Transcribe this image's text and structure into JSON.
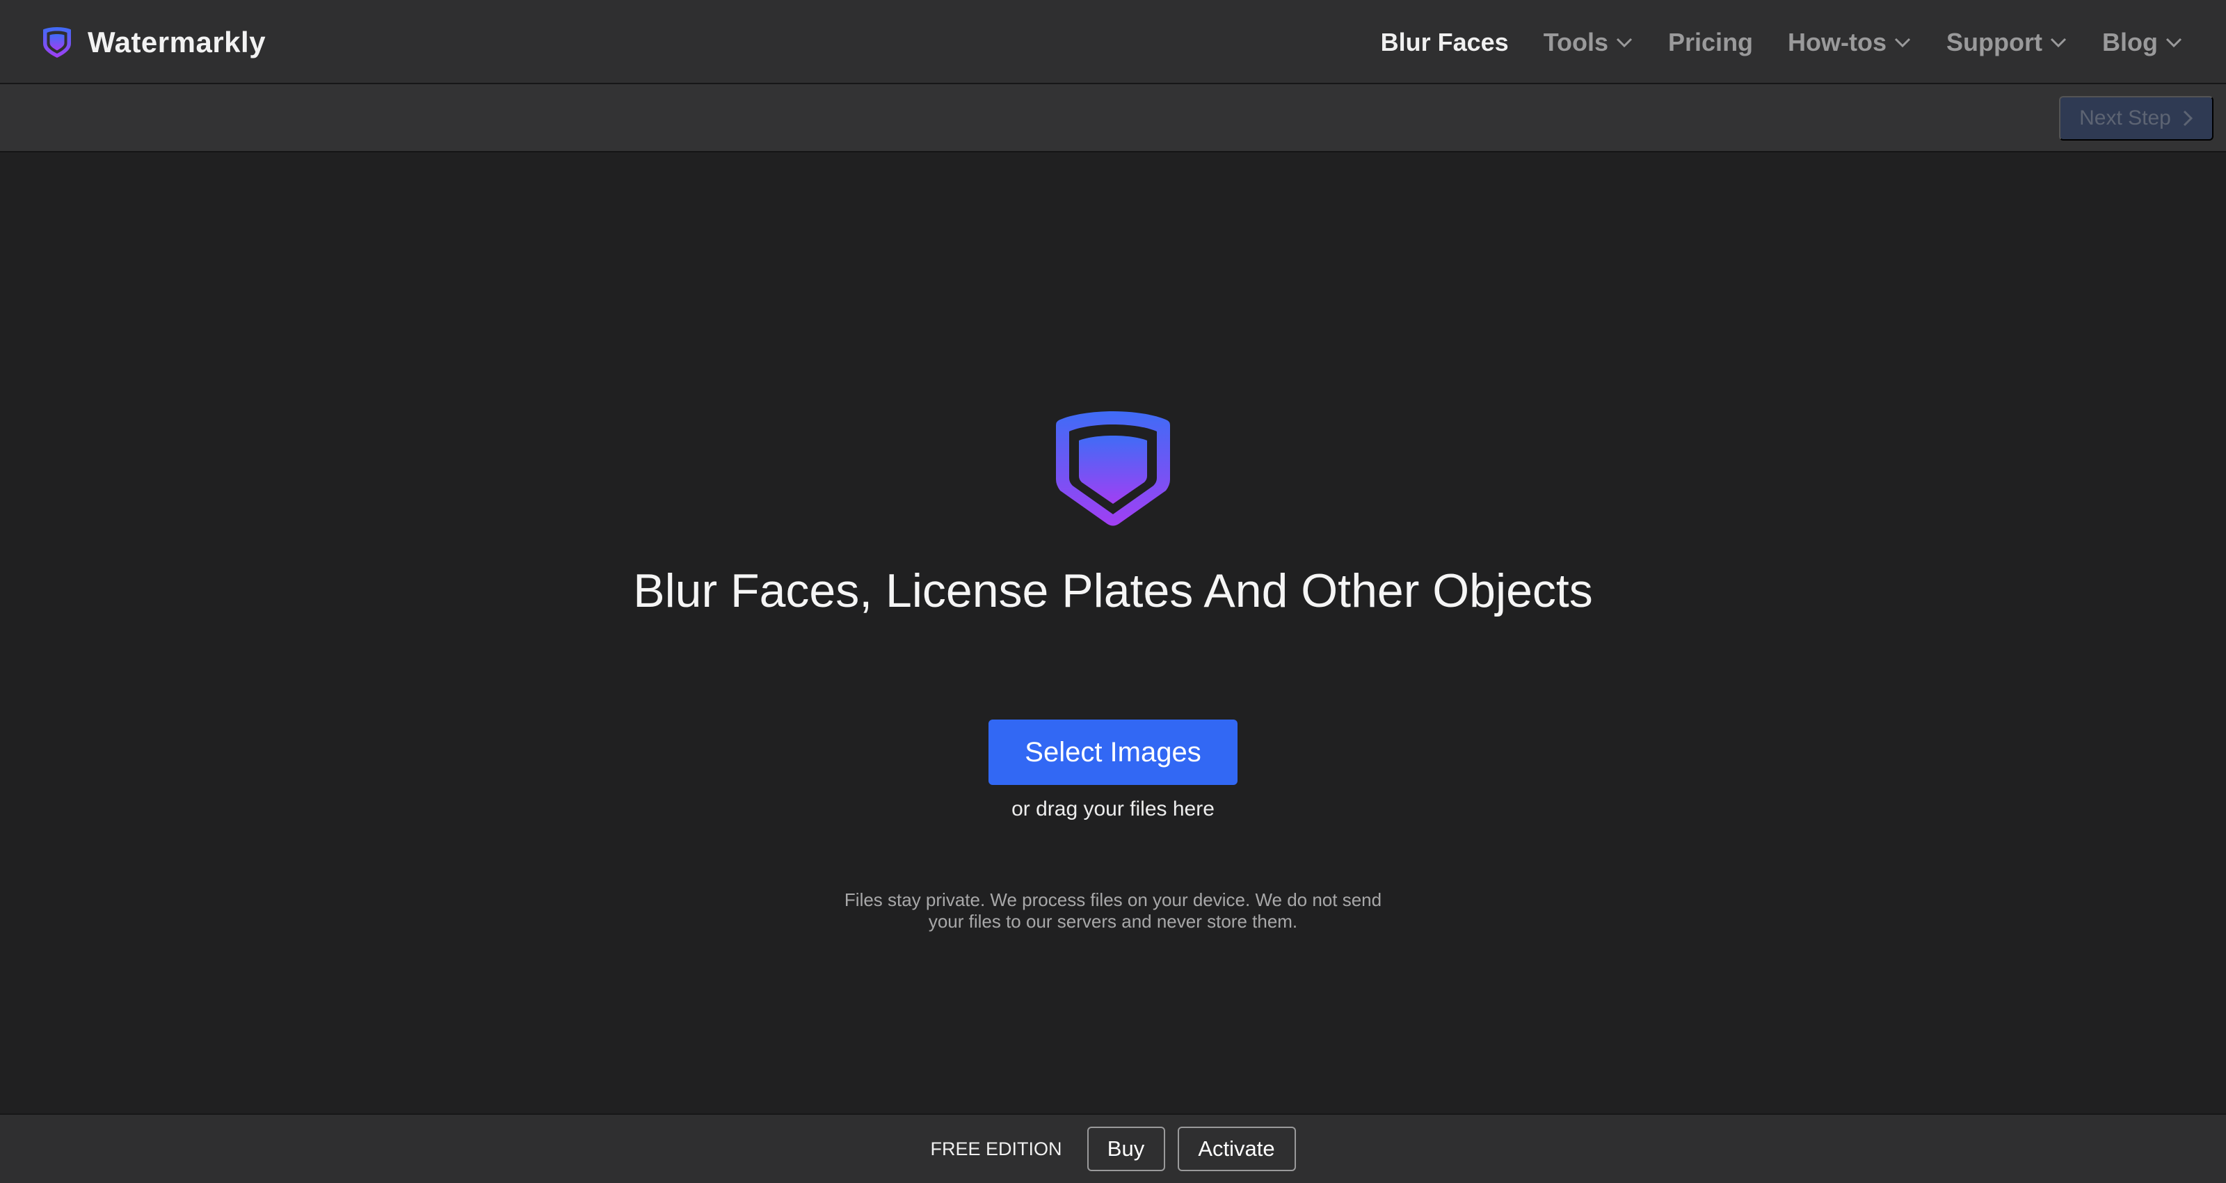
{
  "header": {
    "brand_name": "Watermarkly",
    "logo_icon": "shield-icon",
    "nav": [
      {
        "label": "Blur Faces",
        "active": true,
        "dropdown": false
      },
      {
        "label": "Tools",
        "active": false,
        "dropdown": true
      },
      {
        "label": "Pricing",
        "active": false,
        "dropdown": false
      },
      {
        "label": "How-tos",
        "active": false,
        "dropdown": true
      },
      {
        "label": "Support",
        "active": false,
        "dropdown": true
      },
      {
        "label": "Blog",
        "active": false,
        "dropdown": true
      }
    ]
  },
  "toolbar": {
    "next_step_label": "Next Step",
    "next_step_enabled": false
  },
  "main": {
    "title": "Blur Faces, License Plates And Other Objects",
    "select_button_label": "Select Images",
    "drag_hint": "or drag your files here",
    "privacy_note": "Files stay private. We process files on your device. We do not send your files to our servers and never store them."
  },
  "footer": {
    "edition_label": "FREE EDITION",
    "buy_label": "Buy",
    "activate_label": "Activate"
  },
  "colors": {
    "accent": "#3268f4",
    "logo_gradient_top": "#3f6cf6",
    "logo_gradient_bottom": "#a13ff3",
    "background": "#202021"
  }
}
